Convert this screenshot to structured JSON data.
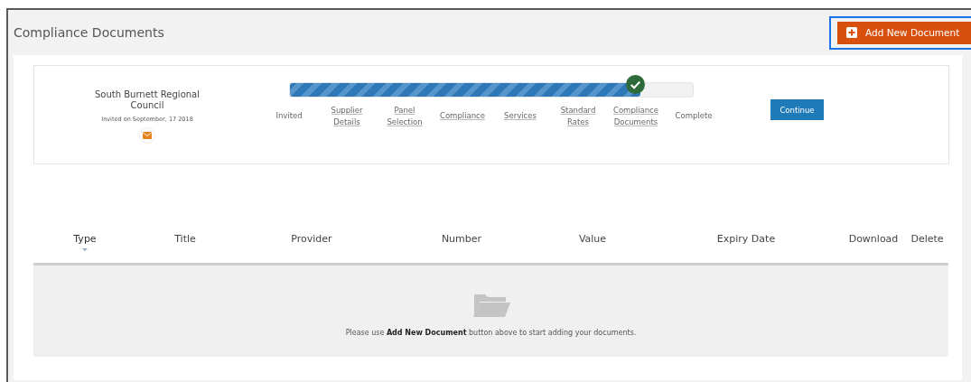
{
  "header": {
    "title": "Compliance Documents",
    "add_button": {
      "label": "Add New Document",
      "focused": true
    }
  },
  "invitation": {
    "organisation": "South Burnett Regional Council",
    "invited_on": "Invited on September, 17 2018"
  },
  "progress": {
    "level": 0.87
  },
  "steps": [
    {
      "label": "Invited",
      "link": false,
      "current": false
    },
    {
      "label": "Supplier Details",
      "link": true,
      "current": false
    },
    {
      "label": "Panel Selection",
      "link": true,
      "current": false
    },
    {
      "label": "Compliance",
      "link": true,
      "current": false
    },
    {
      "label": "Services",
      "link": true,
      "current": false
    },
    {
      "label": "Standard Rates",
      "link": true,
      "current": false
    },
    {
      "label": "Compliance Documents",
      "link": true,
      "current": true
    },
    {
      "label": "Complete",
      "link": false,
      "current": false
    }
  ],
  "continue_button": "Continue",
  "table": {
    "columns": [
      {
        "label": "Type",
        "sorted": true
      },
      {
        "label": "Title",
        "sorted": false
      },
      {
        "label": "Provider",
        "sorted": false
      },
      {
        "label": "Number",
        "sorted": false
      },
      {
        "label": "Value",
        "sorted": false
      },
      {
        "label": "Expiry Date",
        "sorted": false
      },
      {
        "label": "Download",
        "sorted": false
      },
      {
        "label": "Delete",
        "sorted": false
      }
    ],
    "empty_message": "Please use **Add New Document** button above to start adding your documents."
  }
}
